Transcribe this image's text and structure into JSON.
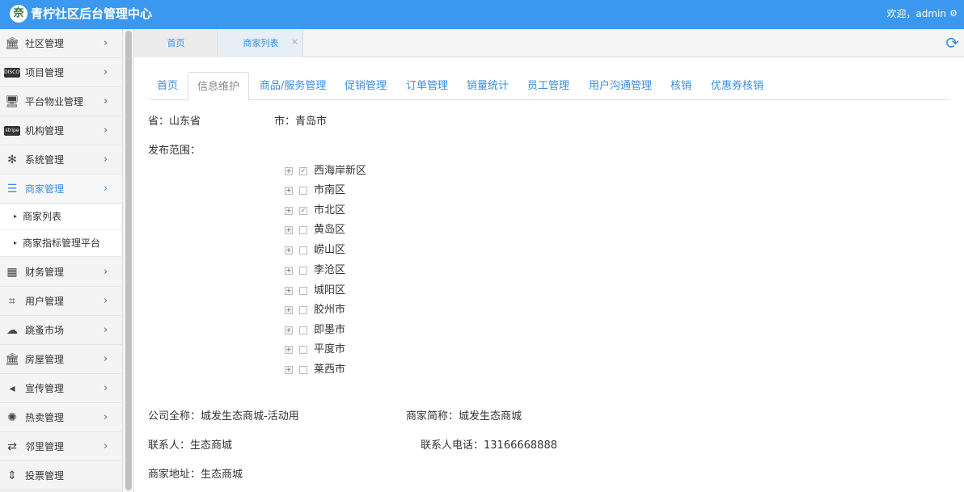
{
  "header": {
    "logo_glyph": "奈",
    "title": "青柠社区后台管理中心",
    "welcome": "欢迎，admin",
    "gear": "⚙"
  },
  "sidebar": {
    "items": [
      {
        "icon": "bank-icon",
        "glyph": "🏛",
        "label": "社区管理",
        "arrow": "›"
      },
      {
        "icon": "discover-card-icon",
        "glyph": "DISCOVER",
        "label": "项目管理",
        "arrow": "›"
      },
      {
        "icon": "monitor-icon",
        "glyph": "🖥",
        "label": "平台物业管理",
        "arrow": "›"
      },
      {
        "icon": "stripe-icon",
        "glyph": "stripe",
        "label": "机构管理",
        "arrow": "›"
      },
      {
        "icon": "yelp-icon",
        "glyph": "✻",
        "label": "系统管理",
        "arrow": "›"
      },
      {
        "icon": "bars-icon",
        "glyph": "☰",
        "label": "商家管理",
        "arrow": "›",
        "active": true
      },
      {
        "icon": "calculator-icon",
        "glyph": "▦",
        "label": "财务管理",
        "arrow": "›"
      },
      {
        "icon": "crop-icon",
        "glyph": "⌗",
        "label": "用户管理",
        "arrow": "›"
      },
      {
        "icon": "cloud-icon",
        "glyph": "☁",
        "label": "跳蚤市场",
        "arrow": "›"
      },
      {
        "icon": "bank-icon",
        "glyph": "🏛",
        "label": "房屋管理",
        "arrow": "›"
      },
      {
        "icon": "volume-icon",
        "glyph": "◂",
        "label": "宣传管理",
        "arrow": "›"
      },
      {
        "icon": "sun-icon",
        "glyph": "✺",
        "label": "热卖管理",
        "arrow": "›"
      },
      {
        "icon": "retweet-icon",
        "glyph": "⇄",
        "label": "邻里管理",
        "arrow": "›"
      },
      {
        "icon": "sort-icon",
        "glyph": "⇕",
        "label": "投票管理",
        "arrow": ""
      }
    ],
    "subitems": [
      {
        "caret": "▸",
        "label": "商家列表"
      },
      {
        "caret": "▸",
        "label": "商家指标管理平台"
      }
    ]
  },
  "page_tabs": [
    {
      "label": "首页"
    },
    {
      "label": "商家列表",
      "close": "×"
    }
  ],
  "refresh_glyph": "⟳",
  "content_tabs": [
    {
      "label": "首页"
    },
    {
      "label": "信息维护",
      "active": true
    },
    {
      "label": "商品/服务管理"
    },
    {
      "label": "促销管理"
    },
    {
      "label": "订单管理"
    },
    {
      "label": "销量统计"
    },
    {
      "label": "员工管理"
    },
    {
      "label": "用户沟通管理"
    },
    {
      "label": "核销"
    },
    {
      "label": "优惠券核销"
    }
  ],
  "info": {
    "province": "省：山东省",
    "city": "市：青岛市",
    "scope_label": "发布范围：",
    "company_full": "公司全称：城发生态商城-活动用",
    "company_short": "商家简称：城发生态商城",
    "contact": "联系人：生态商城",
    "contact_phone": "联系人电话：13166668888",
    "address": "商家地址：生态商城"
  },
  "regions": [
    {
      "name": "西海岸新区",
      "checked": true
    },
    {
      "name": "市南区",
      "checked": false
    },
    {
      "name": "市北区",
      "checked": true
    },
    {
      "name": "黄岛区",
      "checked": false
    },
    {
      "name": "崂山区",
      "checked": false
    },
    {
      "name": "李沧区",
      "checked": false
    },
    {
      "name": "城阳区",
      "checked": false
    },
    {
      "name": "胶州市",
      "checked": false
    },
    {
      "name": "即墨市",
      "checked": false
    },
    {
      "name": "平度市",
      "checked": false
    },
    {
      "name": "莱西市",
      "checked": false
    }
  ],
  "tree": {
    "expand_glyph": "+",
    "check_glyph": "✓"
  },
  "colors": {
    "accent": "#3a98f0",
    "link": "#3a8ee6"
  }
}
